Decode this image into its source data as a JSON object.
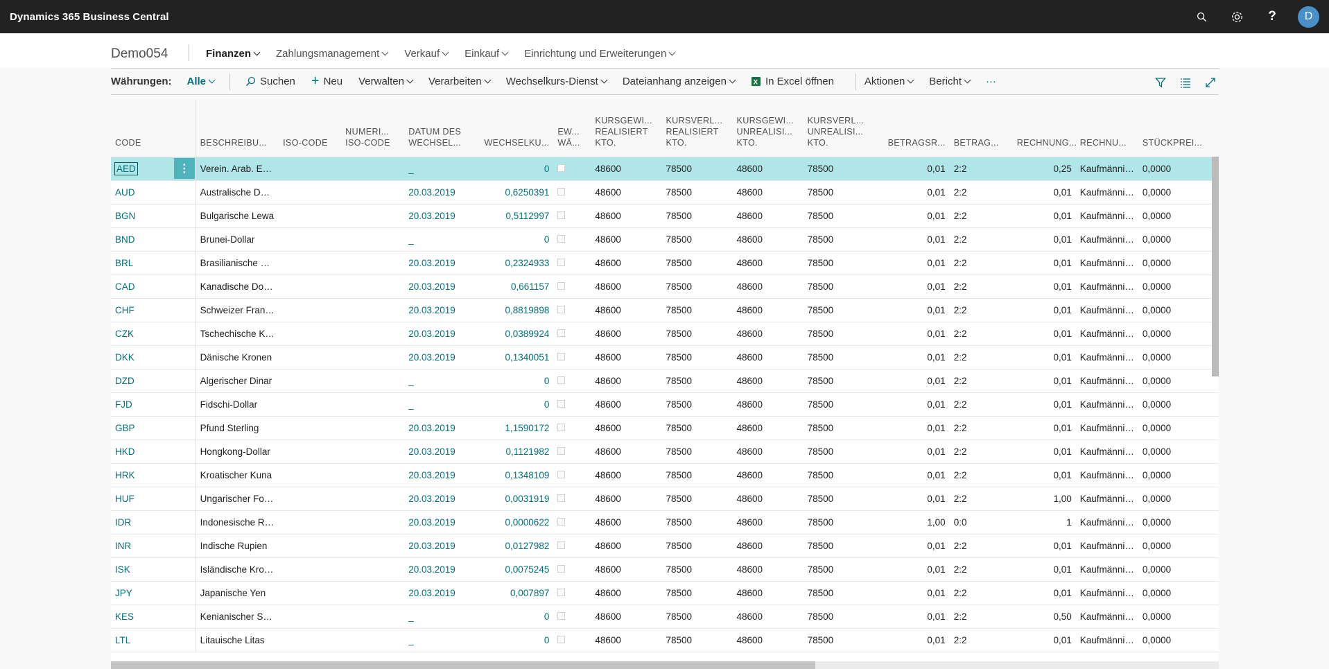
{
  "app": {
    "title": "Dynamics 365 Business Central",
    "avatar_initial": "D",
    "accent": "#00707a",
    "icons": [
      "search-icon",
      "settings-icon",
      "help-icon"
    ]
  },
  "nav": {
    "company": "Demo054",
    "items": [
      {
        "label": "Finanzen",
        "active": true
      },
      {
        "label": "Zahlungsmanagement",
        "active": false
      },
      {
        "label": "Verkauf",
        "active": false
      },
      {
        "label": "Einkauf",
        "active": false
      },
      {
        "label": "Einrichtung und Erweiterungen",
        "active": false
      }
    ]
  },
  "actionbar": {
    "title": "Währungen:",
    "filter": "Alle",
    "search": "Suchen",
    "new": "Neu",
    "manage": "Verwalten",
    "process": "Verarbeiten",
    "exchange_service": "Wechselkurs-Dienst",
    "attachments": "Dateianhang anzeigen",
    "excel": "In Excel öffnen",
    "actions": "Aktionen",
    "report": "Bericht",
    "more": "···"
  },
  "table": {
    "headers": {
      "code": "CODE",
      "desc": "BESCHREIBU...",
      "iso": "ISO-CODE",
      "numiso": "NUMERI... ISO-CODE",
      "date": "DATUM DES WECHSEL...",
      "rate": "WECHSELKU...",
      "ew": "EW... WÄ...",
      "gain_real": "KURSGEWI... REALISIERT KTO.",
      "loss_real": "KURSVERL... REALISIERT KTO.",
      "gain_unreal": "KURSGEWI... UNREALISI... KTO.",
      "loss_unreal": "KURSVERL... UNREALISI... KTO.",
      "amount_round": "BETRAGSR...",
      "amount": "BETRAG...",
      "invoice": "RECHNUNG...",
      "invoice2": "RECHNU...",
      "unit_price": "STÜCKPREI..."
    },
    "rows": [
      {
        "code": "AED",
        "desc": "Verein. Arab. Em...",
        "date": "_",
        "rate": "0",
        "gain_real": "48600",
        "loss_real": "78500",
        "gain_unreal": "48600",
        "loss_unreal": "78500",
        "amount_round": "0,01",
        "amount": "2:2",
        "invoice": "0,25",
        "invoice2": "Kaufmännis...",
        "unit_price": "0,0000"
      },
      {
        "code": "AUD",
        "desc": "Australische Doll...",
        "date": "20.03.2019",
        "rate": "0,6250391",
        "gain_real": "48600",
        "loss_real": "78500",
        "gain_unreal": "48600",
        "loss_unreal": "78500",
        "amount_round": "0,01",
        "amount": "2:2",
        "invoice": "0,01",
        "invoice2": "Kaufmännis...",
        "unit_price": "0,0000"
      },
      {
        "code": "BGN",
        "desc": "Bulgarische Lewa",
        "date": "20.03.2019",
        "rate": "0,5112997",
        "gain_real": "48600",
        "loss_real": "78500",
        "gain_unreal": "48600",
        "loss_unreal": "78500",
        "amount_round": "0,01",
        "amount": "2:2",
        "invoice": "0,01",
        "invoice2": "Kaufmännis...",
        "unit_price": "0,0000"
      },
      {
        "code": "BND",
        "desc": "Brunei-Dollar",
        "date": "_",
        "rate": "0",
        "gain_real": "48600",
        "loss_real": "78500",
        "gain_unreal": "48600",
        "loss_unreal": "78500",
        "amount_round": "0,01",
        "amount": "2:2",
        "invoice": "0,01",
        "invoice2": "Kaufmännis...",
        "unit_price": "0,0000"
      },
      {
        "code": "BRL",
        "desc": "Brasilianische Re...",
        "date": "20.03.2019",
        "rate": "0,2324933",
        "gain_real": "48600",
        "loss_real": "78500",
        "gain_unreal": "48600",
        "loss_unreal": "78500",
        "amount_round": "0,01",
        "amount": "2:2",
        "invoice": "0,01",
        "invoice2": "Kaufmännis...",
        "unit_price": "0,0000"
      },
      {
        "code": "CAD",
        "desc": "Kanadische Dollar",
        "date": "20.03.2019",
        "rate": "0,661157",
        "gain_real": "48600",
        "loss_real": "78500",
        "gain_unreal": "48600",
        "loss_unreal": "78500",
        "amount_round": "0,01",
        "amount": "2:2",
        "invoice": "0,01",
        "invoice2": "Kaufmännis...",
        "unit_price": "0,0000"
      },
      {
        "code": "CHF",
        "desc": "Schweizer Frank...",
        "date": "20.03.2019",
        "rate": "0,8819898",
        "gain_real": "48600",
        "loss_real": "78500",
        "gain_unreal": "48600",
        "loss_unreal": "78500",
        "amount_round": "0,01",
        "amount": "2:2",
        "invoice": "0,01",
        "invoice2": "Kaufmännis...",
        "unit_price": "0,0000"
      },
      {
        "code": "CZK",
        "desc": "Tschechische Kr...",
        "date": "20.03.2019",
        "rate": "0,0389924",
        "gain_real": "48600",
        "loss_real": "78500",
        "gain_unreal": "48600",
        "loss_unreal": "78500",
        "amount_round": "0,01",
        "amount": "2:2",
        "invoice": "0,01",
        "invoice2": "Kaufmännis...",
        "unit_price": "0,0000"
      },
      {
        "code": "DKK",
        "desc": "Dänische Kronen",
        "date": "20.03.2019",
        "rate": "0,1340051",
        "gain_real": "48600",
        "loss_real": "78500",
        "gain_unreal": "48600",
        "loss_unreal": "78500",
        "amount_round": "0,01",
        "amount": "2:2",
        "invoice": "0,01",
        "invoice2": "Kaufmännis...",
        "unit_price": "0,0000"
      },
      {
        "code": "DZD",
        "desc": "Algerischer Dinar",
        "date": "_",
        "rate": "0",
        "gain_real": "48600",
        "loss_real": "78500",
        "gain_unreal": "48600",
        "loss_unreal": "78500",
        "amount_round": "0,01",
        "amount": "2:2",
        "invoice": "0,01",
        "invoice2": "Kaufmännis...",
        "unit_price": "0,0000"
      },
      {
        "code": "FJD",
        "desc": "Fidschi-Dollar",
        "date": "_",
        "rate": "0",
        "gain_real": "48600",
        "loss_real": "78500",
        "gain_unreal": "48600",
        "loss_unreal": "78500",
        "amount_round": "0,01",
        "amount": "2:2",
        "invoice": "0,01",
        "invoice2": "Kaufmännis...",
        "unit_price": "0,0000"
      },
      {
        "code": "GBP",
        "desc": "Pfund Sterling",
        "date": "20.03.2019",
        "rate": "1,1590172",
        "gain_real": "48600",
        "loss_real": "78500",
        "gain_unreal": "48600",
        "loss_unreal": "78500",
        "amount_round": "0,01",
        "amount": "2:2",
        "invoice": "0,01",
        "invoice2": "Kaufmännis...",
        "unit_price": "0,0000"
      },
      {
        "code": "HKD",
        "desc": "Hongkong-Dollar",
        "date": "20.03.2019",
        "rate": "0,1121982",
        "gain_real": "48600",
        "loss_real": "78500",
        "gain_unreal": "48600",
        "loss_unreal": "78500",
        "amount_round": "0,01",
        "amount": "2:2",
        "invoice": "0,01",
        "invoice2": "Kaufmännis...",
        "unit_price": "0,0000"
      },
      {
        "code": "HRK",
        "desc": "Kroatischer Kuna",
        "date": "20.03.2019",
        "rate": "0,1348109",
        "gain_real": "48600",
        "loss_real": "78500",
        "gain_unreal": "48600",
        "loss_unreal": "78500",
        "amount_round": "0,01",
        "amount": "2:2",
        "invoice": "0,01",
        "invoice2": "Kaufmännis...",
        "unit_price": "0,0000"
      },
      {
        "code": "HUF",
        "desc": "Ungarischer Fori...",
        "date": "20.03.2019",
        "rate": "0,0031919",
        "gain_real": "48600",
        "loss_real": "78500",
        "gain_unreal": "48600",
        "loss_unreal": "78500",
        "amount_round": "0,01",
        "amount": "2:2",
        "invoice": "1,00",
        "invoice2": "Kaufmännis...",
        "unit_price": "0,0000"
      },
      {
        "code": "IDR",
        "desc": "Indonesische Ru...",
        "date": "20.03.2019",
        "rate": "0,0000622",
        "gain_real": "48600",
        "loss_real": "78500",
        "gain_unreal": "48600",
        "loss_unreal": "78500",
        "amount_round": "1,00",
        "amount": "0:0",
        "invoice": "1",
        "invoice2": "Kaufmännis...",
        "unit_price": "0,0000"
      },
      {
        "code": "INR",
        "desc": "Indische Rupien",
        "date": "20.03.2019",
        "rate": "0,0127982",
        "gain_real": "48600",
        "loss_real": "78500",
        "gain_unreal": "48600",
        "loss_unreal": "78500",
        "amount_round": "0,01",
        "amount": "2:2",
        "invoice": "0,01",
        "invoice2": "Kaufmännis...",
        "unit_price": "0,0000"
      },
      {
        "code": "ISK",
        "desc": "Isländische Kron...",
        "date": "20.03.2019",
        "rate": "0,0075245",
        "gain_real": "48600",
        "loss_real": "78500",
        "gain_unreal": "48600",
        "loss_unreal": "78500",
        "amount_round": "0,01",
        "amount": "2:2",
        "invoice": "0,01",
        "invoice2": "Kaufmännis...",
        "unit_price": "0,0000"
      },
      {
        "code": "JPY",
        "desc": "Japanische Yen",
        "date": "20.03.2019",
        "rate": "0,007897",
        "gain_real": "48600",
        "loss_real": "78500",
        "gain_unreal": "48600",
        "loss_unreal": "78500",
        "amount_round": "0,01",
        "amount": "2:2",
        "invoice": "0,01",
        "invoice2": "Kaufmännis...",
        "unit_price": "0,0000"
      },
      {
        "code": "KES",
        "desc": "Kenianischer Sc...",
        "date": "_",
        "rate": "0",
        "gain_real": "48600",
        "loss_real": "78500",
        "gain_unreal": "48600",
        "loss_unreal": "78500",
        "amount_round": "0,01",
        "amount": "2:2",
        "invoice": "0,50",
        "invoice2": "Kaufmännis...",
        "unit_price": "0,0000"
      },
      {
        "code": "LTL",
        "desc": "Litauische Litas",
        "date": "_",
        "rate": "0",
        "gain_real": "48600",
        "loss_real": "78500",
        "gain_unreal": "48600",
        "loss_unreal": "78500",
        "amount_round": "0,01",
        "amount": "2:2",
        "invoice": "0,01",
        "invoice2": "Kaufmännis...",
        "unit_price": "0,0000"
      }
    ]
  }
}
